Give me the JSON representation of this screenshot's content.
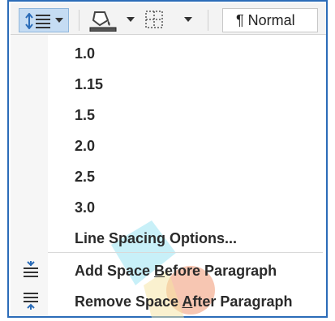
{
  "ribbon": {
    "line_spacing_icon": "line-spacing-icon",
    "shading_icon": "paint-bucket-icon",
    "borders_icon": "borders-icon",
    "dropdown_icon": "chevron-down-icon",
    "style_name": "¶ Normal",
    "accent": "#2b6cb8",
    "selected_bg": "#c5dcf3"
  },
  "menu": {
    "spacing_options": [
      "1.0",
      "1.15",
      "1.5",
      "2.0",
      "2.5",
      "3.0"
    ],
    "line_spacing_options": "Line Spacing Options...",
    "add_space_before": {
      "pre": "Add Space ",
      "key": "B",
      "post": "efore Paragraph",
      "icon": "add-space-before-icon"
    },
    "remove_space_after": {
      "pre": "Remove Space ",
      "key": "A",
      "post": "fter Paragraph",
      "icon": "remove-space-after-icon"
    }
  }
}
